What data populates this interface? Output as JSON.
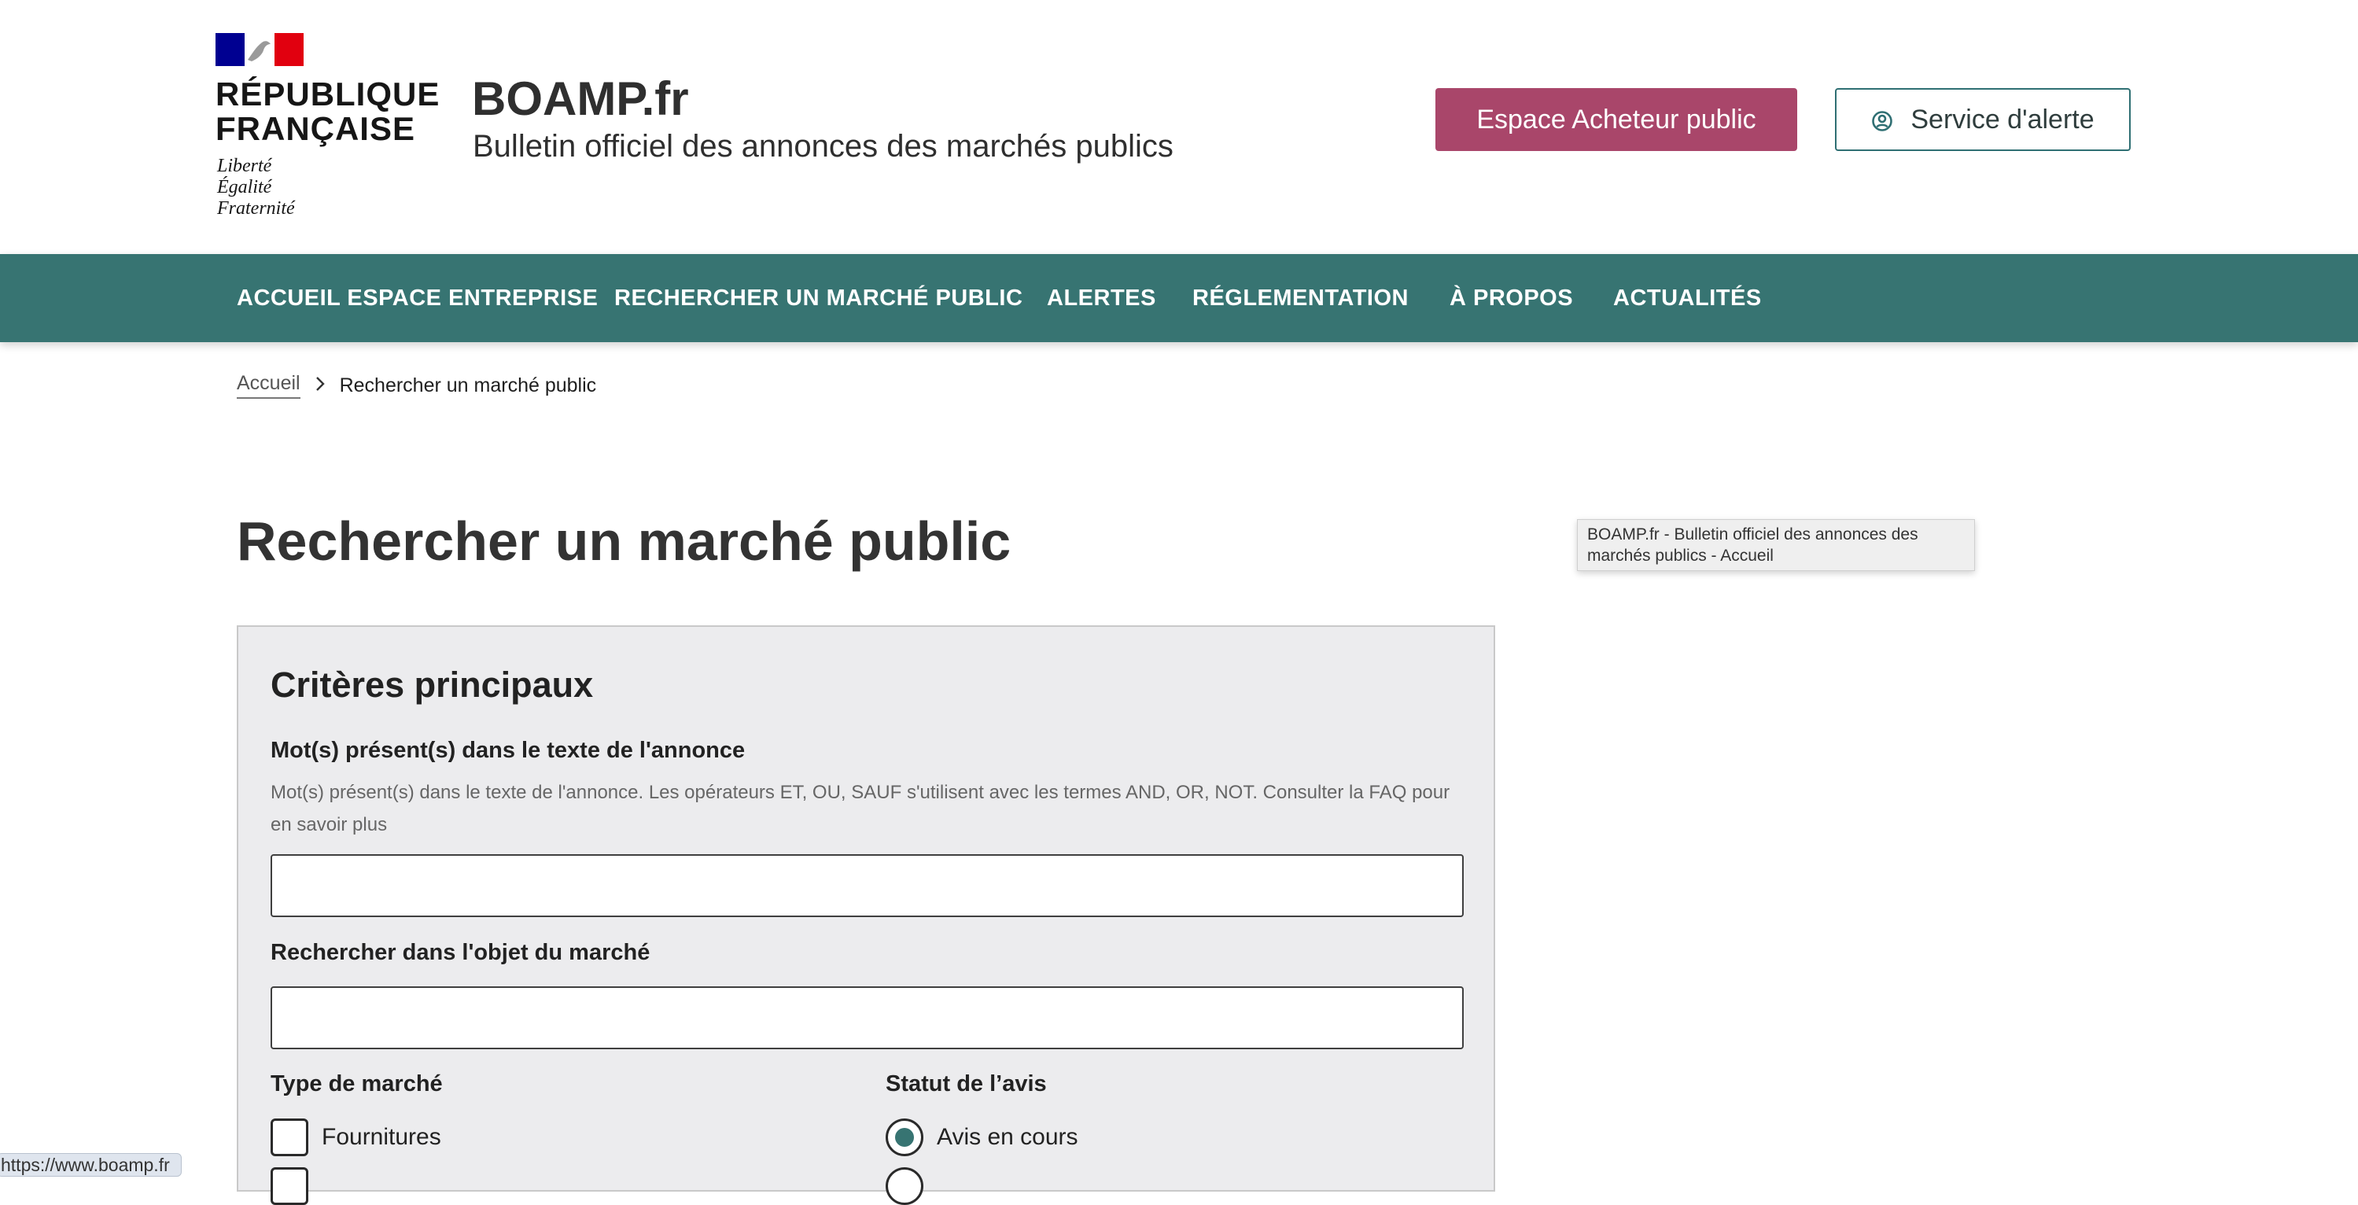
{
  "header": {
    "rf_title_line1": "RÉPUBLIQUE",
    "rf_title_line2": "FRANÇAISE",
    "rf_motto_1": "Liberté",
    "rf_motto_2": "Égalité",
    "rf_motto_3": "Fraternité",
    "site_name": "BOAMP.fr",
    "site_tagline": "Bulletin officiel des annonces des marchés publics",
    "btn_acheteur": "Espace Acheteur public",
    "btn_alerte": "Service d'alerte"
  },
  "nav": {
    "items": [
      {
        "label": "ACCUEIL ESPACE ENTREPRISE"
      },
      {
        "label": "RECHERCHER UN MARCHÉ PUBLIC"
      },
      {
        "label": "ALERTES"
      },
      {
        "label": "RÉGLEMENTATION"
      },
      {
        "label": "À PROPOS"
      },
      {
        "label": "ACTUALITÉS"
      }
    ]
  },
  "breadcrumb": {
    "home": "Accueil",
    "current": "Rechercher un marché public"
  },
  "page": {
    "title": "Rechercher un marché public"
  },
  "tooltip": {
    "text": "BOAMP.fr - Bulletin officiel des annonces des marchés publics - Accueil"
  },
  "form": {
    "panel_title": "Critères principaux",
    "keywords_label": "Mot(s) présent(s) dans le texte de l'annonce",
    "keywords_hint": "Mot(s) présent(s) dans le texte de l'annonce. Les opérateurs ET, OU, SAUF s'utilisent avec les termes AND, OR, NOT. Consulter la FAQ pour en savoir plus",
    "keywords_value": "",
    "object_label": "Rechercher dans l'objet du marché",
    "object_value": "",
    "type_label": "Type de marché",
    "type_options": [
      {
        "label": "Fournitures",
        "checked": false
      }
    ],
    "status_label": "Statut de l’avis",
    "status_options": [
      {
        "label": "Avis en cours",
        "selected": true
      }
    ]
  },
  "statusbar": {
    "url": "https://www.boamp.fr"
  },
  "colors": {
    "nav_bg": "#377472",
    "acheteur_btn": "#a9466a",
    "panel_bg": "#ececee",
    "radio_selected": "#377472"
  }
}
